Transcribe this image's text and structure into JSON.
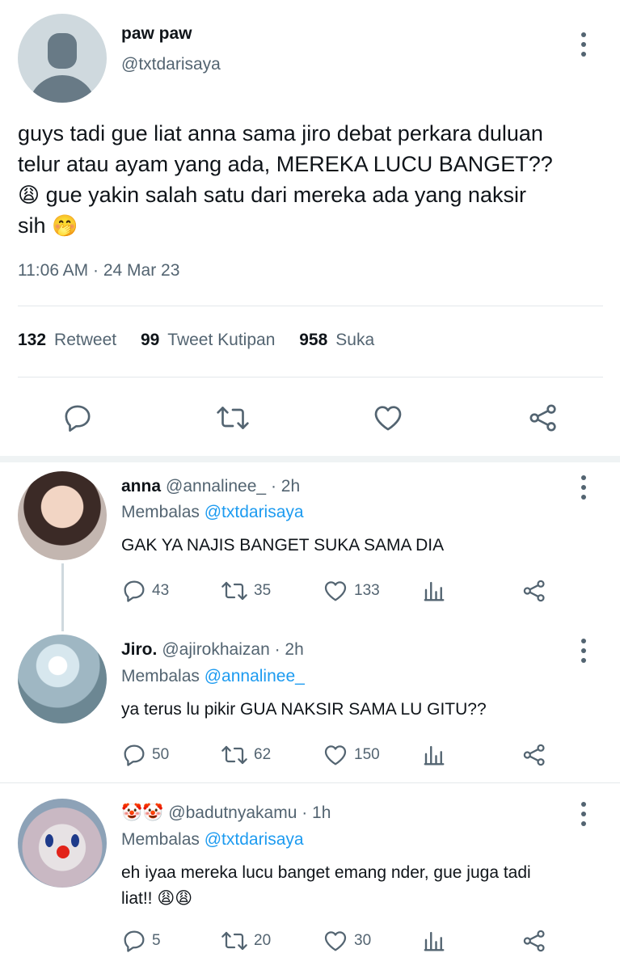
{
  "main_tweet": {
    "display_name": "paw paw",
    "handle": "@txtdarisaya",
    "text_line1": "guys tadi gue liat anna sama jiro debat perkara duluan",
    "text_line2": "telur atau ayam yang ada, MEREKA LUCU BANGET??",
    "text_line3_emoji": "😩",
    "text_line3": " gue yakin salah satu dari mereka ada yang naksir",
    "text_line4": "sih ",
    "text_line4_emoji": "🤭",
    "timestamp": "11:06 AM · 24 Mar 23",
    "stats": {
      "retweets_count": "132",
      "retweets_label": "Retweet",
      "quotes_count": "99",
      "quotes_label": "Tweet Kutipan",
      "likes_count": "958",
      "likes_label": "Suka"
    },
    "actions": [
      "reply-icon",
      "retweet-icon",
      "like-icon",
      "share-icon"
    ]
  },
  "replies": [
    {
      "display_name": "anna",
      "handle": "@annalinee_",
      "time": "· 2h",
      "reply_prefix": "Membalas",
      "reply_to": "@txtdarisaya",
      "text": "GAK YA NAJIS BANGET SUKA SAMA DIA",
      "replies": "43",
      "retweets": "35",
      "likes": "133"
    },
    {
      "display_name": "Jiro.",
      "handle": "@ajirokhaizan",
      "time": "· 2h",
      "reply_prefix": "Membalas",
      "reply_to": "@annalinee_",
      "text": "ya terus lu pikir GUA NAKSIR SAMA LU GITU??",
      "replies": "50",
      "retweets": "62",
      "likes": "150"
    },
    {
      "display_name": "🤡🤡",
      "handle": "@badutnyakamu",
      "time": "· 1h",
      "reply_prefix": "Membalas",
      "reply_to": "@txtdarisaya",
      "text_line1": "eh iyaa mereka lucu banget emang nder, gue juga tadi",
      "text_line2": "liat!! 😩😩",
      "replies": "5",
      "retweets": "20",
      "likes": "30"
    }
  ],
  "colors": {
    "text_primary": "#0f1419",
    "text_secondary": "#536471",
    "link": "#1d9bf0",
    "divider": "#e4e8eb"
  }
}
